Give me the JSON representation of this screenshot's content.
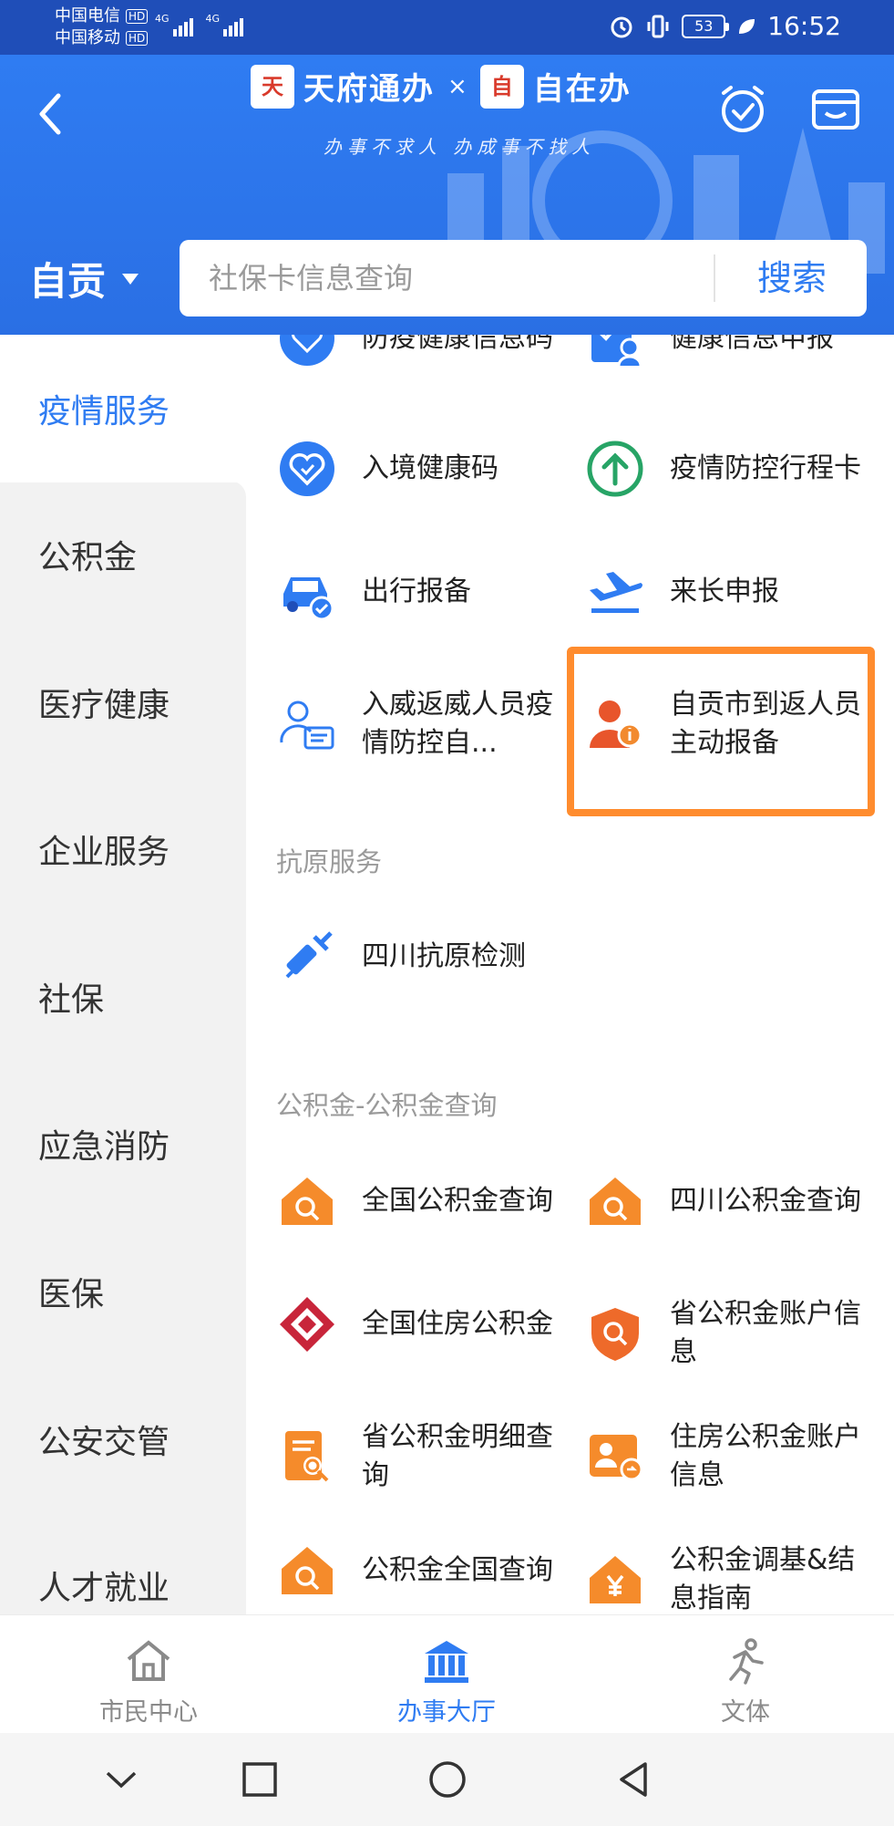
{
  "status_bar": {
    "carrier1": "中国电信",
    "carrier2": "中国移动",
    "hd": "HD",
    "net1": "4G",
    "net2": "4G",
    "battery": "53",
    "time": "16:52"
  },
  "header": {
    "logo_left": "天府通办",
    "logo_x": "×",
    "logo_right": "自在办",
    "logo_badge_left": "天",
    "logo_badge_right": "自",
    "slogan": "办事不求人 办成事不找人",
    "city": "自贡",
    "search_placeholder": "社保卡信息查询",
    "search_button": "搜索"
  },
  "sidebar": {
    "items": [
      {
        "label": "疫情服务"
      },
      {
        "label": "公积金"
      },
      {
        "label": "医疗健康"
      },
      {
        "label": "企业服务"
      },
      {
        "label": "社保"
      },
      {
        "label": "应急消防"
      },
      {
        "label": "医保"
      },
      {
        "label": "公安交管"
      },
      {
        "label": "人才就业"
      }
    ]
  },
  "services": {
    "partial_left": "防疫健康信息码",
    "partial_right": "健康信息申报",
    "entry_health_code": "入境健康码",
    "epidemic_trip_card": "疫情防控行程卡",
    "travel_report": "出行报备",
    "laichang_report": "来长申报",
    "weihai_return": "入威返威人员疫情防控自...",
    "zigong_return": "自贡市到返人员主动报备",
    "section_antigen": "抗原服务",
    "sichuan_antigen": "四川抗原检测",
    "section_fund": "公积金-公积金查询",
    "national_fund_query": "全国公积金查询",
    "sichuan_fund_query": "四川公积金查询",
    "national_housing_fund": "全国住房公积金",
    "province_fund_account": "省公积金账户信息",
    "province_fund_detail": "省公积金明细查询",
    "housing_fund_account": "住房公积金账户信息",
    "fund_national_query": "公积金全国查询",
    "fund_adjust_guide": "公积金调基&结息指南"
  },
  "bottom_nav": {
    "items": [
      {
        "label": "市民中心"
      },
      {
        "label": "办事大厅"
      },
      {
        "label": "文体"
      }
    ]
  },
  "colors": {
    "primary": "#2f7cf2",
    "highlight": "#ff8c2e",
    "fund_orange": "#f58b2b",
    "green": "#27a466"
  }
}
